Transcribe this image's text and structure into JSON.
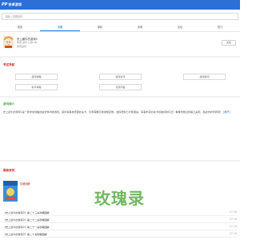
{
  "header": {
    "logo_mark": "PP",
    "logo_text": "安卓游戏",
    "bg_color": "#2d6fd6"
  },
  "search": {
    "placeholder": "请输入您要找的",
    "icon": "search-icon"
  },
  "nav": {
    "tabs": [
      {
        "label": "首页"
      },
      {
        "label": "攻略"
      },
      {
        "label": "单机"
      },
      {
        "label": "安卓"
      },
      {
        "label": "论坛"
      },
      {
        "label": "热门"
      }
    ],
    "active_index": 1
  },
  "game": {
    "title": "史上最牛的游戏2",
    "meta": "休闲 益智  公测 0M",
    "tag": "休闲益智",
    "follow_label": "关注"
  },
  "tools": {
    "title": "专区导航",
    "items": [
      {
        "label": "游戏攻略"
      },
      {
        "label": "游戏资讯"
      },
      {
        "label": "游戏新闻"
      },
      {
        "label": "新手攻略"
      },
      {
        "label": "玩家问答"
      }
    ]
  },
  "intro": {
    "title": "游戏简介",
    "text": "史上最牛的游戏2是一款非常烧脑的益智休闲类游戏，其中有各种奇葩的关卡，玩家需要打破常规思维，发挥想象力才能通关，有着丰富的关卡和独特的玩法！看看你能过到第几关吧，挑战你的智商吧！",
    "more_label": "[展开]"
  },
  "latest": {
    "title": "最新资讯",
    "feature_title": "攻略图解",
    "articles": [
      {
        "title": "《史上最牛的游戏2》第二十三关攻略图解",
        "date": "07-18"
      },
      {
        "title": "《史上最牛的游戏2》第二十二关攻略图解",
        "date": "07-18"
      },
      {
        "title": "《史上最牛的游戏2》第二十一关攻略图解",
        "date": "07-18"
      },
      {
        "title": "《史上最牛的游戏2》第二十关攻略图解",
        "date": "07-18"
      }
    ]
  },
  "watermark": {
    "text": "玫瑰录"
  },
  "colors": {
    "accent": "#2d6fd6",
    "section_red": "#d32f2f",
    "section_green": "#4caf50"
  }
}
